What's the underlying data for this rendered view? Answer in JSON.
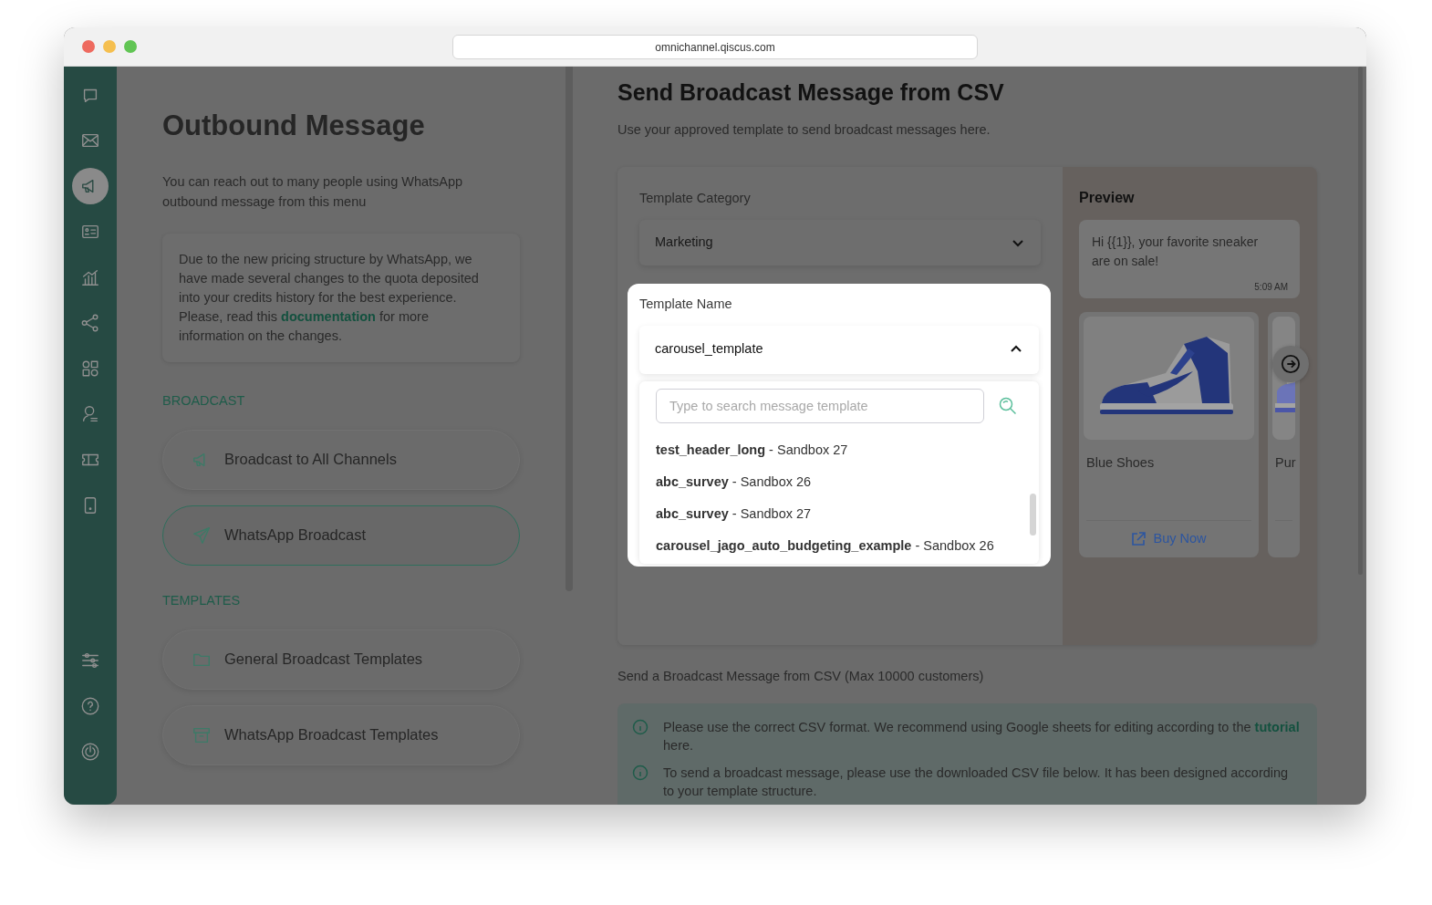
{
  "browser": {
    "url": "omnichannel.qiscus.com"
  },
  "nav": {
    "items": [
      {
        "selected": false
      },
      {
        "selected": false
      },
      {
        "selected": true
      },
      {
        "selected": false
      },
      {
        "selected": false
      },
      {
        "selected": false
      },
      {
        "selected": false
      },
      {
        "selected": false
      },
      {
        "selected": false
      },
      {
        "selected": false
      }
    ],
    "bottom_items": [
      {
        "selected": false
      },
      {
        "selected": false
      },
      {
        "selected": false
      }
    ]
  },
  "left": {
    "title": "Outbound Message",
    "description": "You can reach out to many people using WhatsApp outbound message from this menu",
    "notice": {
      "before": "Due to the new pricing structure by WhatsApp, we have made several changes to the quota deposited into your credits history for the best experience. Please, read this ",
      "link": "documentation",
      "after": " for more information on the changes."
    },
    "sections": [
      {
        "heading": "BROADCAST",
        "items": [
          {
            "label": "Broadcast to All Channels",
            "selected": false
          },
          {
            "label": "WhatsApp Broadcast",
            "selected": true
          }
        ]
      },
      {
        "heading": "TEMPLATES",
        "items": [
          {
            "label": "General Broadcast Templates",
            "selected": false
          },
          {
            "label": "WhatsApp Broadcast Templates",
            "selected": false
          }
        ]
      }
    ]
  },
  "main": {
    "title": "Send Broadcast Message from CSV",
    "subtitle": "Use your approved template to send broadcast messages here.",
    "category": {
      "label": "Template Category",
      "value": "Marketing",
      "expanded": false
    },
    "template_name": {
      "label": "Template Name",
      "value": "carousel_template",
      "expanded": true
    },
    "search": {
      "placeholder": "Type to search message template"
    },
    "options": [
      "**test_header_long** - Sandbox 27",
      "**abc_survey** - Sandbox 26",
      "**abc_survey** - Sandbox 27",
      "**carousel_jago_auto_budgeting_example** - Sandbox 26"
    ],
    "preview": {
      "title": "Preview",
      "message": "Hi {{1}}, your favorite sneaker are on sale!",
      "time": "5:09 AM",
      "cards": [
        {
          "title": "Blue Shoes",
          "button": "Buy Now"
        },
        {
          "title": "Pur"
        }
      ]
    },
    "csv_label": "Send a Broadcast Message from CSV (Max 10000 customers)",
    "notes": [
      {
        "before": "Please use the correct CSV format. We recommend using Google sheets for editing according to the ",
        "link": "tutorial",
        "after": " here."
      },
      {
        "before": "To send a broadcast message, please use the downloaded CSV file below. It has been designed according to your template structure."
      }
    ]
  }
}
